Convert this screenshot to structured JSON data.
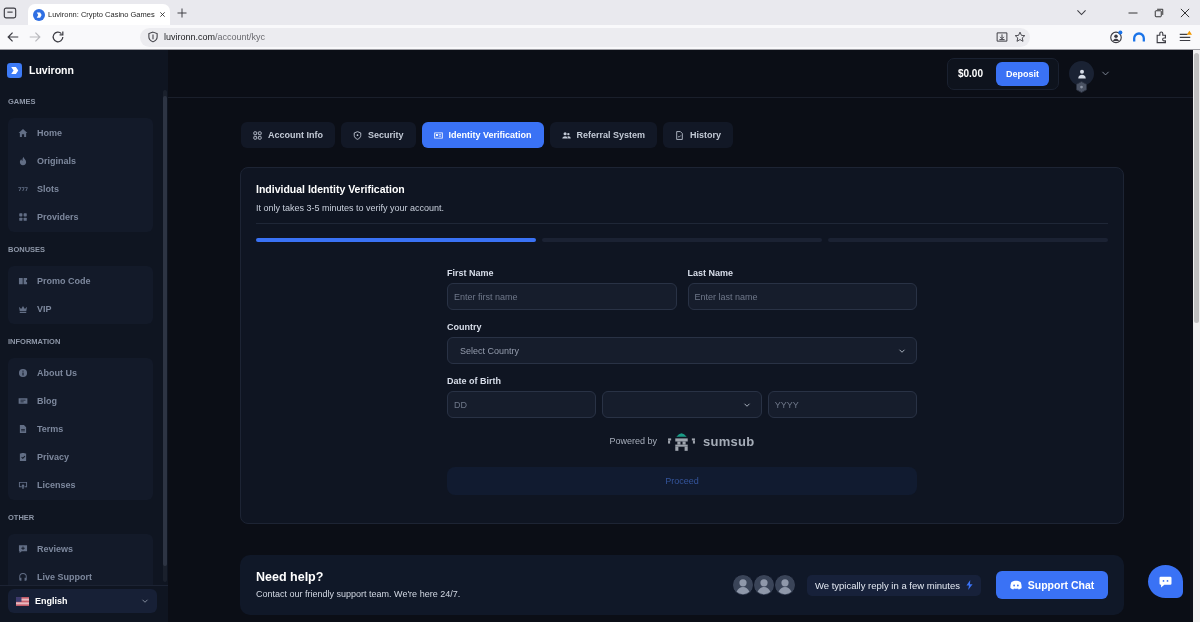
{
  "browser": {
    "tab_title": "Luvironn: Crypto Casino Games",
    "url_host": "luvironn.com",
    "url_path": "/account/kyc",
    "forward_disabled": true
  },
  "sidebar": {
    "brand": "Luvironn",
    "sections": [
      {
        "title": "GAMES",
        "items": [
          {
            "label": "Home",
            "selected": false
          },
          {
            "label": "Originals",
            "selected": false
          },
          {
            "label": "Slots",
            "selected": false
          },
          {
            "label": "Providers",
            "selected": false
          }
        ]
      },
      {
        "title": "BONUSES",
        "items": [
          {
            "label": "Promo Code",
            "selected": false
          },
          {
            "label": "VIP",
            "selected": false
          }
        ]
      },
      {
        "title": "INFORMATION",
        "items": [
          {
            "label": "About Us",
            "selected": false
          },
          {
            "label": "Blog",
            "selected": false
          },
          {
            "label": "Terms",
            "selected": false
          },
          {
            "label": "Privacy",
            "selected": false
          },
          {
            "label": "Licenses",
            "selected": false
          }
        ]
      },
      {
        "title": "OTHER",
        "items": [
          {
            "label": "Reviews",
            "selected": false
          },
          {
            "label": "Live Support",
            "selected": false
          }
        ]
      }
    ],
    "language": "English"
  },
  "header": {
    "balance": "$0.00",
    "deposit_button": "Deposit"
  },
  "tabs": [
    {
      "label": "Account Info",
      "selected": false
    },
    {
      "label": "Security",
      "selected": false
    },
    {
      "label": "Identity Verification",
      "selected": true
    },
    {
      "label": "Referral System",
      "selected": false
    },
    {
      "label": "History",
      "selected": false
    }
  ],
  "verification": {
    "title": "Individual Identity Verification",
    "subtitle": "It only takes 3-5 minutes to verify your account.",
    "steps": [
      {
        "done": true
      },
      {
        "done": false
      },
      {
        "done": false
      }
    ]
  },
  "form": {
    "first_name": {
      "label": "First Name",
      "placeholder": "Enter first name"
    },
    "last_name": {
      "label": "Last Name",
      "placeholder": "Enter last name"
    },
    "country": {
      "label": "Country",
      "placeholder": "Select Country"
    },
    "date_of_birth": {
      "label": "Date of Birth",
      "day_placeholder": "DD",
      "year_placeholder": "YYYY"
    },
    "powered_by": "Powered by",
    "provider": "sumsub",
    "proceed": {
      "label": "Proceed",
      "disabled": true
    }
  },
  "help": {
    "title": "Need help?",
    "text": "Contact our friendly support team. We're here 24/7.",
    "reply_note": "We typically reply in a few minutes",
    "button": "Support Chat"
  }
}
